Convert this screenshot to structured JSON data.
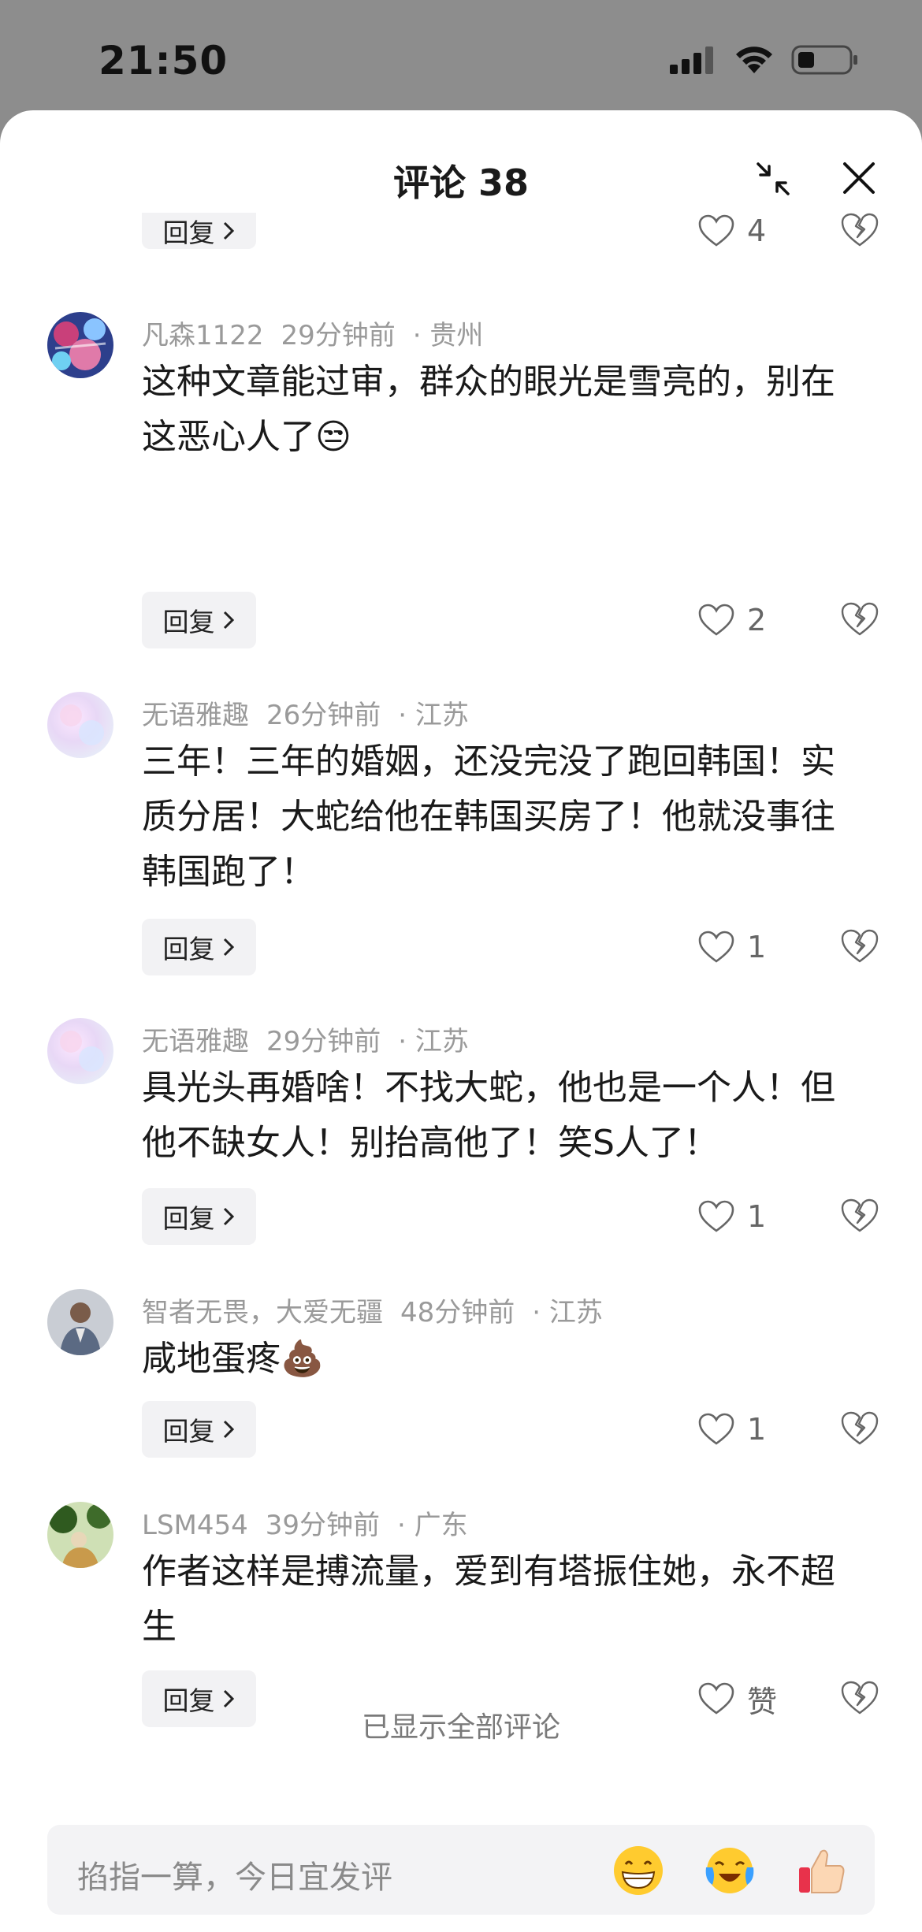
{
  "status_bar": {
    "time": "21:50",
    "icons": [
      "cellular-signal-icon",
      "wifi-icon",
      "battery-icon"
    ]
  },
  "header": {
    "title": "评论 38",
    "collapse_icon": "collapse-arrows-icon",
    "close_icon": "close-icon"
  },
  "top_partial_row": {
    "reply_label": "回复",
    "like_count": "4"
  },
  "comments": [
    {
      "username": "凡森1122",
      "time": "29分钟前",
      "location": "· 贵州",
      "text": "这种文章能过审，群众的眼光是雪亮的，别在这恶心人了😒",
      "reply_label": "回复",
      "like_count": "2"
    },
    {
      "username": "无语雅趣",
      "time": "26分钟前",
      "location": "· 江苏",
      "text": "三年！三年的婚姻，还没完没了跑回韩国！实质分居！大蛇给他在韩国买房了！他就没事往韩国跑了！",
      "reply_label": "回复",
      "like_count": "1"
    },
    {
      "username": "无语雅趣",
      "time": "29分钟前",
      "location": "· 江苏",
      "text": "具光头再婚啥！不找大蛇，他也是一个人！但他不缺女人！别抬高他了！笑S人了！",
      "reply_label": "回复",
      "like_count": "1"
    },
    {
      "username": "智者无畏，大爱无疆",
      "time": "48分钟前",
      "location": "· 江苏",
      "text": "咸地蛋疼💩",
      "reply_label": "回复",
      "like_count": "1"
    },
    {
      "username": "LSM454",
      "time": "39分钟前",
      "location": "· 广东",
      "text": "作者这样是搏流量，爱到有塔振住她，永不超生",
      "reply_label": "回复",
      "like_count": "赞"
    }
  ],
  "footer": {
    "all_shown": "已显示全部评论"
  },
  "input_bar": {
    "placeholder": "掐指一算，今日宜发评",
    "emoji_buttons": [
      "grinning-emoji-icon",
      "crying-laughing-emoji-icon",
      "thumbs-up-emoji-icon"
    ]
  },
  "colors": {
    "status_bar_bg": "#8d8d8d",
    "sheet_bg": "#ffffff",
    "meta_text": "#9a9a9a",
    "reply_bg": "#f2f2f4"
  }
}
